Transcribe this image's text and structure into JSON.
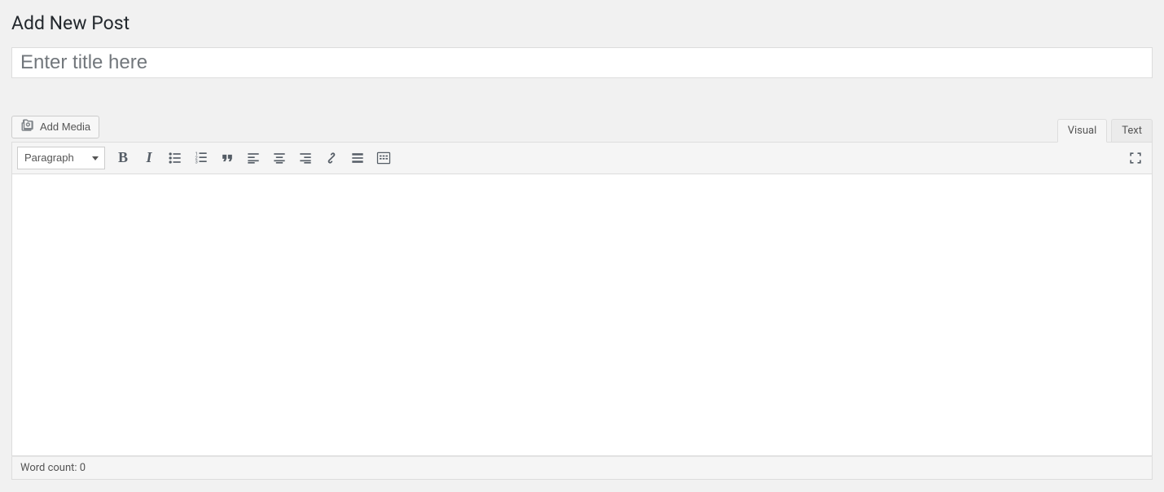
{
  "page": {
    "title": "Add New Post"
  },
  "title_field": {
    "placeholder": "Enter title here",
    "value": ""
  },
  "media_button": {
    "label": "Add Media"
  },
  "tabs": {
    "visual": "Visual",
    "text": "Text",
    "active": "visual"
  },
  "toolbar": {
    "format_select": "Paragraph",
    "buttons": {
      "bold": "B",
      "italic": "I"
    }
  },
  "content": {
    "value": ""
  },
  "status": {
    "word_count_label": "Word count:",
    "word_count": "0"
  }
}
